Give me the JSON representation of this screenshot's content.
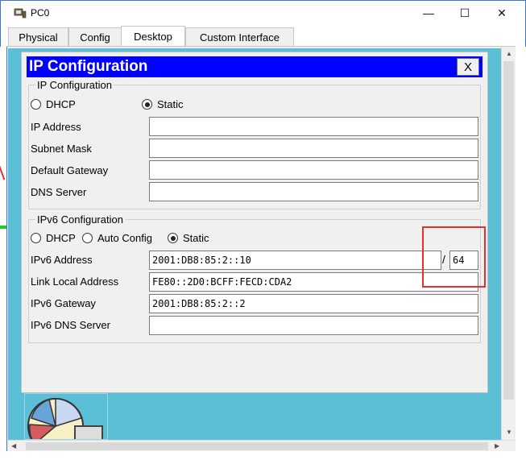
{
  "window": {
    "title": "PC0",
    "min_glyph": "—",
    "max_glyph": "☐",
    "close_glyph": "✕"
  },
  "tabs": [
    {
      "label": "Physical"
    },
    {
      "label": "Config"
    },
    {
      "label": "Desktop",
      "active": true
    },
    {
      "label": "Custom Interface"
    }
  ],
  "dialog": {
    "title": "IP Configuration",
    "close_label": "X",
    "ipv4": {
      "group_title": "IP Configuration",
      "mode_options": [
        "DHCP",
        "Static"
      ],
      "selected_mode": "Static",
      "fields": [
        {
          "label": "IP Address",
          "value": ""
        },
        {
          "label": "Subnet Mask",
          "value": ""
        },
        {
          "label": "Default Gateway",
          "value": ""
        },
        {
          "label": "DNS Server",
          "value": ""
        }
      ]
    },
    "ipv6": {
      "group_title": "IPv6 Configuration",
      "mode_options": [
        "DHCP",
        "Auto Config",
        "Static"
      ],
      "selected_mode": "Static",
      "address_label": "IPv6 Address",
      "address_value": "2001:DB8:85:2::10",
      "prefix_separator": "/",
      "prefix_length": "64",
      "link_local_label": "Link Local Address",
      "link_local_value": "FE80::2D0:BCFF:FECD:CDA2",
      "gateway_label": "IPv6 Gateway",
      "gateway_value": "2001:DB8:85:2::2",
      "dns_label": "IPv6 DNS Server",
      "dns_value": ""
    }
  },
  "colors": {
    "title_bar": "#0000ff",
    "desktop_bg": "#5bbfd6",
    "highlight_box": "#e5312c"
  }
}
